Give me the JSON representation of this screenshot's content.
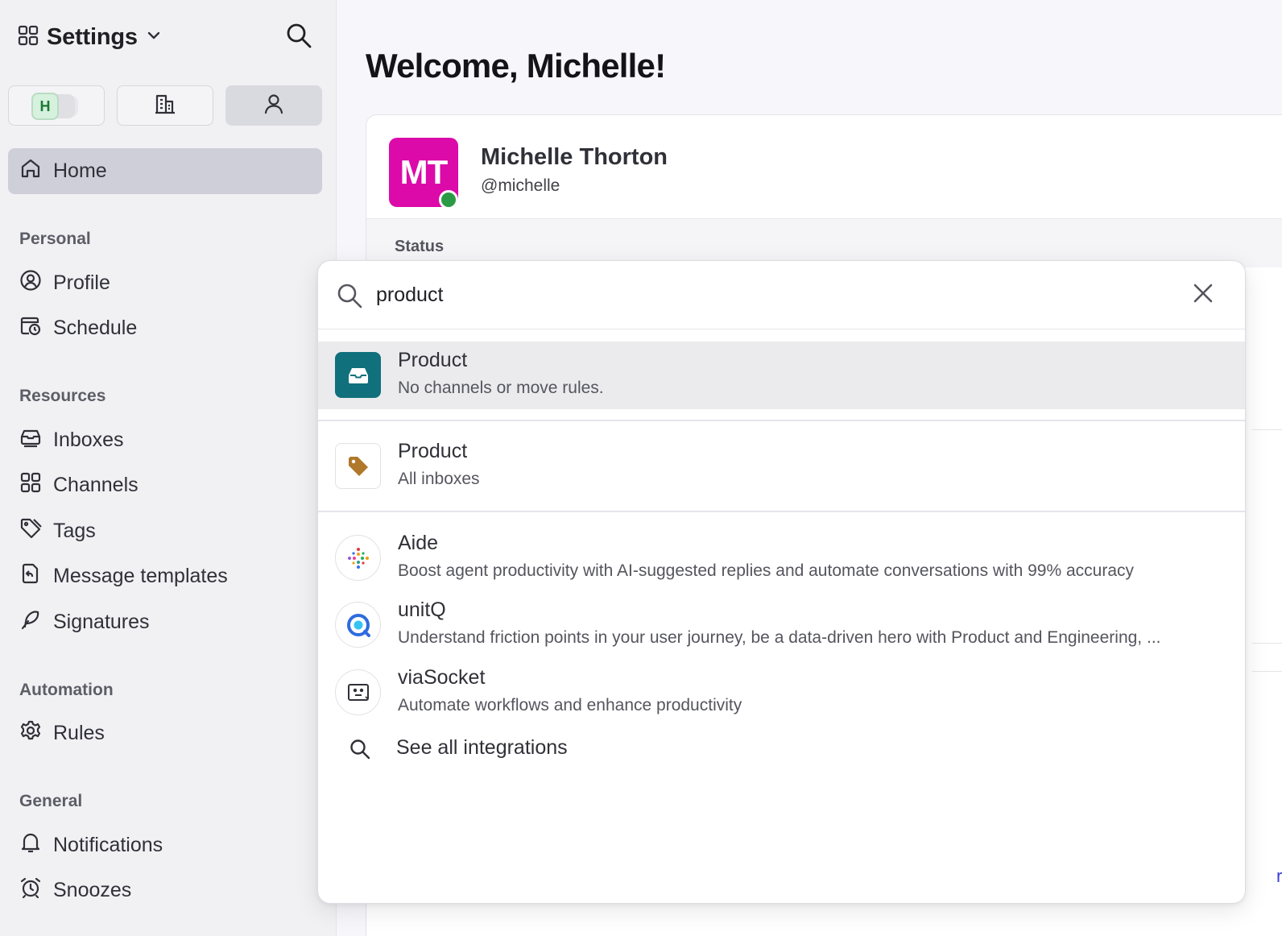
{
  "sidebar": {
    "title": "Settings",
    "team_badge": "H",
    "nav": {
      "home": "Home",
      "personal_label": "Personal",
      "profile": "Profile",
      "schedule": "Schedule",
      "resources_label": "Resources",
      "inboxes": "Inboxes",
      "channels": "Channels",
      "tags": "Tags",
      "message_templates": "Message templates",
      "signatures": "Signatures",
      "automation_label": "Automation",
      "rules": "Rules",
      "general_label": "General",
      "notifications": "Notifications",
      "snoozes": "Snoozes"
    }
  },
  "main": {
    "welcome": "Welcome, Michelle!",
    "profile": {
      "initials": "MT",
      "name": "Michelle Thorton",
      "handle": "@michelle",
      "status_label": "Status"
    },
    "partial_link": "rea"
  },
  "search": {
    "query": "product",
    "results": [
      {
        "title": "Product",
        "subtitle": "No channels or move rules.",
        "icon": "inbox-icon",
        "selected": true
      },
      {
        "title": "Product",
        "subtitle": "All inboxes",
        "icon": "tag-icon"
      },
      {
        "title": "Aide",
        "subtitle": "Boost agent productivity with AI-suggested replies and automate conversations with 99% accuracy",
        "icon": "aide-logo-icon"
      },
      {
        "title": "unitQ",
        "subtitle": "Understand friction points in your user journey, be a data-driven hero with Product and Engineering, ...",
        "icon": "unitq-logo-icon"
      },
      {
        "title": "viaSocket",
        "subtitle": "Automate workflows and enhance productivity",
        "icon": "viasocket-logo-icon"
      }
    ],
    "see_all": "See all integrations"
  },
  "colors": {
    "avatar": "#db0aa9",
    "presence": "#2b9a45",
    "inbox_icon_bg": "#10707c",
    "tag_color": "#b0782a",
    "link": "#3b3bdc"
  }
}
